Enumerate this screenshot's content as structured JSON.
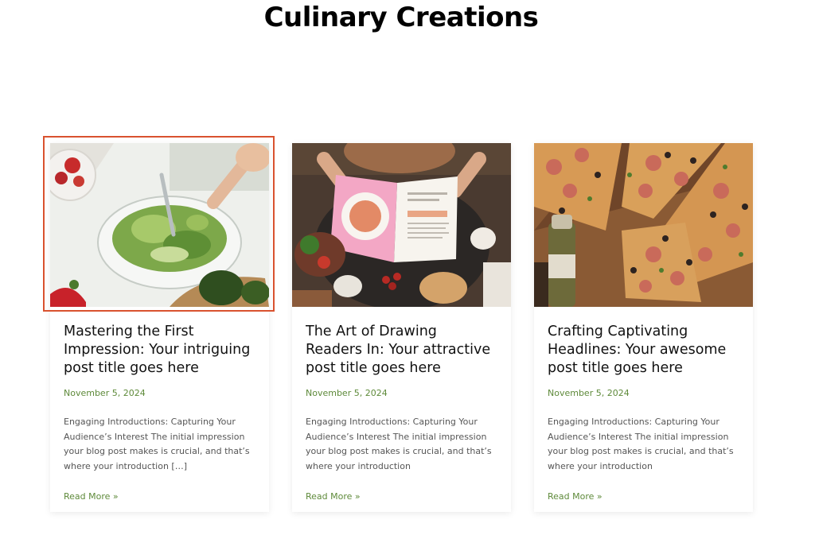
{
  "page": {
    "title": "Culinary Creations"
  },
  "colors": {
    "accent_green": "#5e8a3a",
    "focus_outline": "#d9522f",
    "title_text": "#000000",
    "excerpt_text": "#555555"
  },
  "posts": [
    {
      "image_icon": "salad-bowl-photo",
      "title": "Mastering the First Impression: Your intriguing post title goes here",
      "date": "November 5, 2024",
      "excerpt": "Engaging Introductions: Capturing Your Audience’s Interest The initial impression your blog post makes is crucial, and that’s where your introduction […]",
      "read_more": "Read More »"
    },
    {
      "image_icon": "cookbook-photo",
      "title": "The Art of Drawing Readers In: Your attractive post title goes here",
      "date": "November 5, 2024",
      "excerpt": "Engaging Introductions: Capturing Your Audience’s Interest The initial impression your blog post makes is crucial, and that’s where your introduction",
      "read_more": "Read More »"
    },
    {
      "image_icon": "pizza-photo",
      "title": "Crafting Captivating Headlines: Your awesome post title goes here",
      "date": "November 5, 2024",
      "excerpt": "Engaging Introductions: Capturing Your Audience’s Interest The initial impression your blog post makes is crucial, and that’s where your introduction",
      "read_more": "Read More »"
    }
  ]
}
